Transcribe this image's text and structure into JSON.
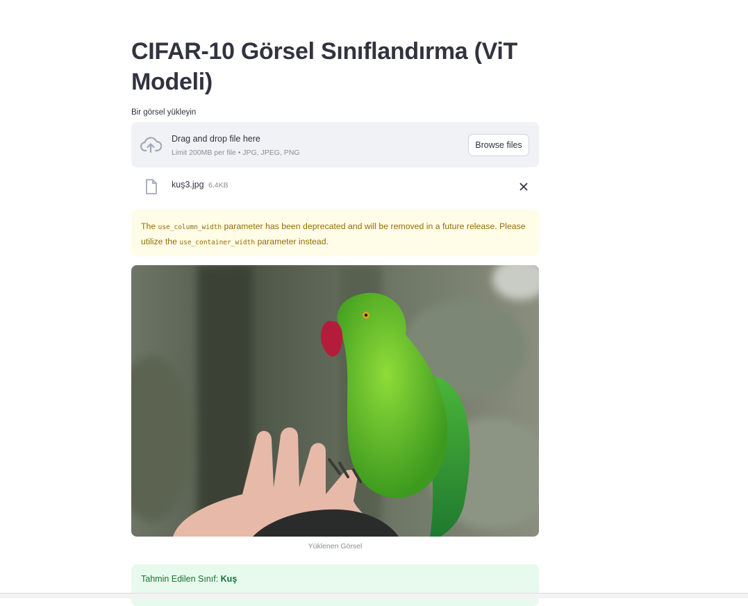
{
  "title": "CIFAR-10 Görsel Sınıflandırma (ViT Modeli)",
  "uploader": {
    "label": "Bir görsel yükleyin",
    "drop_text": "Drag and drop file here",
    "limit_text": "Limit 200MB per file • JPG, JPEG, PNG",
    "browse_label": "Browse files",
    "icon": "cloud-upload-icon"
  },
  "file": {
    "name": "kuş3.jpg",
    "size": "6.4KB",
    "icon": "file-icon",
    "remove_icon": "close-icon"
  },
  "warning": {
    "text_1": "The ",
    "code_1": "use_column_width",
    "text_2": " parameter has been deprecated and will be removed in a future release. Please utilize the ",
    "code_2": "use_container_width",
    "text_3": " parameter instead."
  },
  "image": {
    "caption": "Yüklenen Görsel"
  },
  "result": {
    "label": "Tahmin Edilen Sınıf: ",
    "value": "Kuş"
  },
  "colors": {
    "warning_bg": "#fffce7",
    "warning_text": "#926c05",
    "success_bg": "#e8f9ee",
    "success_text": "#177233",
    "dropzone_bg": "#f0f2f6"
  }
}
